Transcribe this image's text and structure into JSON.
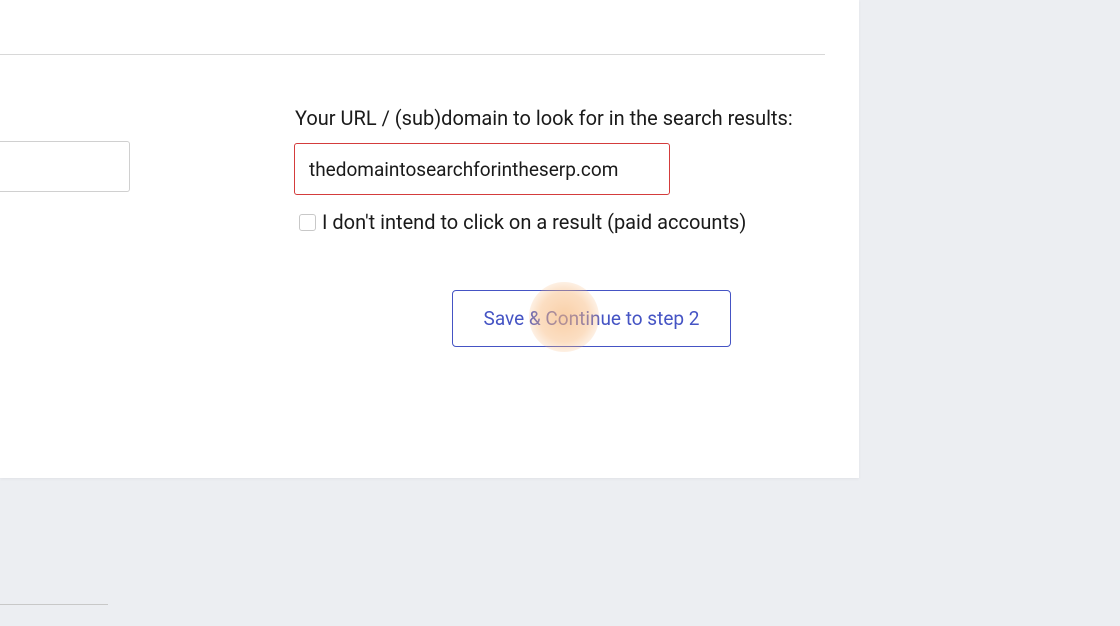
{
  "form": {
    "url_label": "Your URL / (sub)domain to look for in the search results:",
    "url_value": "thedomaintosearchforintheserp.com",
    "checkbox_label": "I don't intend to click on a result (paid accounts)",
    "checkbox_checked": false,
    "continue_label": "Save & Continue to step 2"
  }
}
